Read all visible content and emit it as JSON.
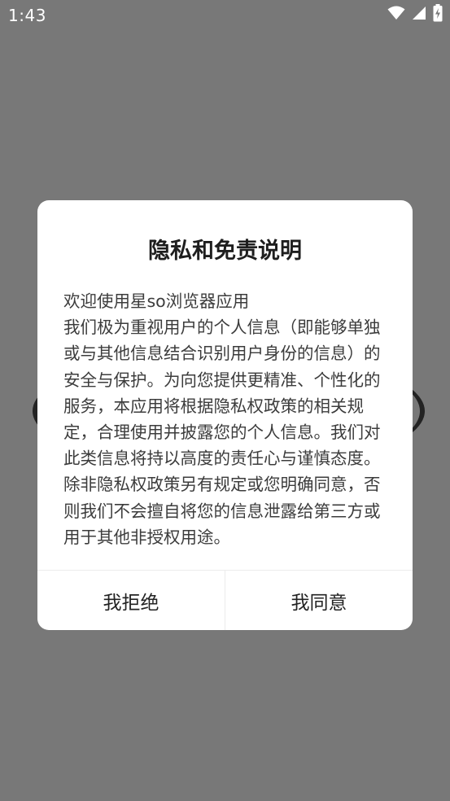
{
  "status_bar": {
    "time": "1:43",
    "icons": [
      "wifi-icon",
      "signal-icon",
      "battery-charging-icon"
    ]
  },
  "dialog": {
    "title": "隐私和免责说明",
    "body": "欢迎使用星so浏览器应用\n我们极为重视用户的个人信息（即能够单独或与其他信息结合识别用户身份的信息）的安全与保护。为向您提供更精准、个性化的服务，本应用将根据隐私权政策的相关规定，合理使用并披露您的个人信息。我们对此类信息将持以高度的责任心与谨慎态度。除非隐私权政策另有规定或您明确同意，否则我们不会擅自将您的信息泄露给第三方或用于其他非授权用途。",
    "reject_label": "我拒绝",
    "agree_label": "我同意"
  },
  "colors": {
    "overlay": "#787878",
    "dialog_bg": "#ffffff",
    "text_primary": "#1e1e1e",
    "text_body": "#3c3c3c"
  }
}
